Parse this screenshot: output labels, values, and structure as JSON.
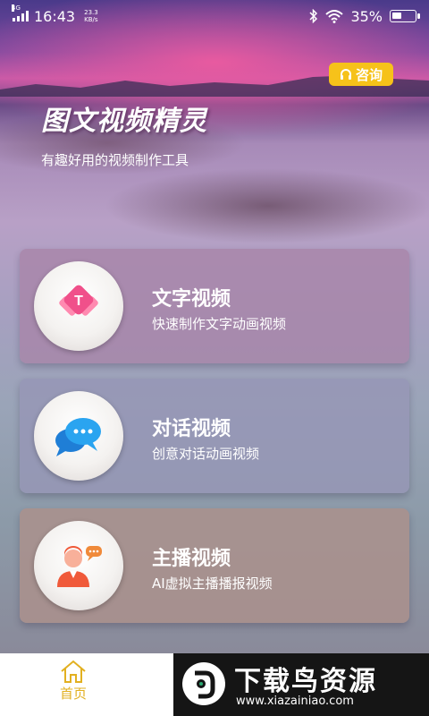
{
  "status_bar": {
    "network_tag": "4G",
    "time": "16:43",
    "speed_value": "23.3",
    "speed_unit": "KB/s",
    "battery": "35%"
  },
  "header": {
    "consult_label": "咨询",
    "title": "图文视频精灵",
    "subtitle": "有趣好用的视频制作工具"
  },
  "cards": [
    {
      "title": "文字视频",
      "desc": "快速制作文字动画视频",
      "icon": "text-badge-icon"
    },
    {
      "title": "对话视频",
      "desc": "创意对话动画视频",
      "icon": "chat-bubbles-icon"
    },
    {
      "title": "主播视频",
      "desc": "AI虚拟主播播报视频",
      "icon": "anchor-person-icon"
    }
  ],
  "tabbar": {
    "home_label": "首页",
    "active_color": "#e2b020"
  },
  "watermark": {
    "title": "下载鸟资源",
    "url": "www.xiazainiao.com"
  },
  "colors": {
    "consult_bg": "#f6c21a",
    "text_icon": "#f0508a",
    "chat_icon": "#2a9ae8",
    "anchor_icon": "#f05a3a"
  }
}
